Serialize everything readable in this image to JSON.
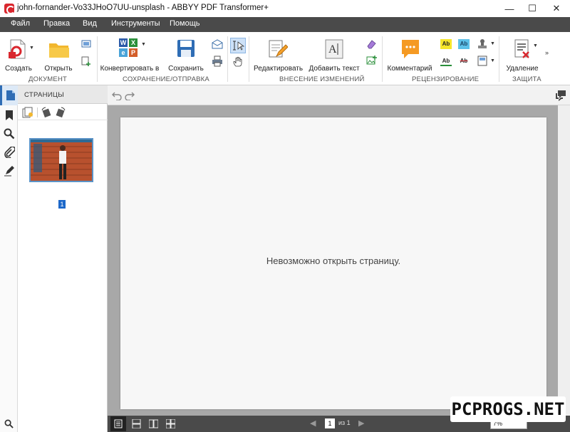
{
  "window": {
    "title": "john-fornander-Vo33JHoO7UU-unsplash - ABBYY PDF Transformer+",
    "controls": {
      "minimize": "—",
      "maximize": "☐",
      "close": "✕"
    }
  },
  "menu": {
    "items": [
      "Файл",
      "Правка",
      "Вид",
      "Инструменты",
      "Помощь"
    ]
  },
  "ribbon": {
    "create": "Создать",
    "open": "Открыть",
    "convert": "Конвертировать в",
    "save": "Сохранить",
    "edit": "Редактировать",
    "add_text": "Добавить текст",
    "comment": "Комментарий",
    "delete": "Удаление",
    "groups": {
      "document": "ДОКУМЕНТ",
      "save_send": "СОХРАНЕНИЕ/ОТПРАВКА",
      "edits": "ВНЕСЕНИЕ ИЗМЕНЕНИЙ",
      "review": "РЕЦЕНЗИРОВАНИЕ",
      "protection": "ЗАЩИТА"
    },
    "convert_tiles": [
      "W",
      "X",
      "e",
      "P"
    ],
    "review_tiles": [
      "Ab",
      "Ab",
      "Ab",
      "Ab"
    ]
  },
  "panel": {
    "title": "СТРАНИЦЫ",
    "thumbnail_number": "1"
  },
  "document": {
    "message": "Невозможно открыть страницу."
  },
  "status": {
    "current_page": "1",
    "of_total": "из 1",
    "zoom": "7%"
  },
  "watermark": "PCPROGS.NET",
  "colors": {
    "menubar": "#4a4a4a",
    "accent": "#1d68c9",
    "brand": "#d9272e"
  }
}
